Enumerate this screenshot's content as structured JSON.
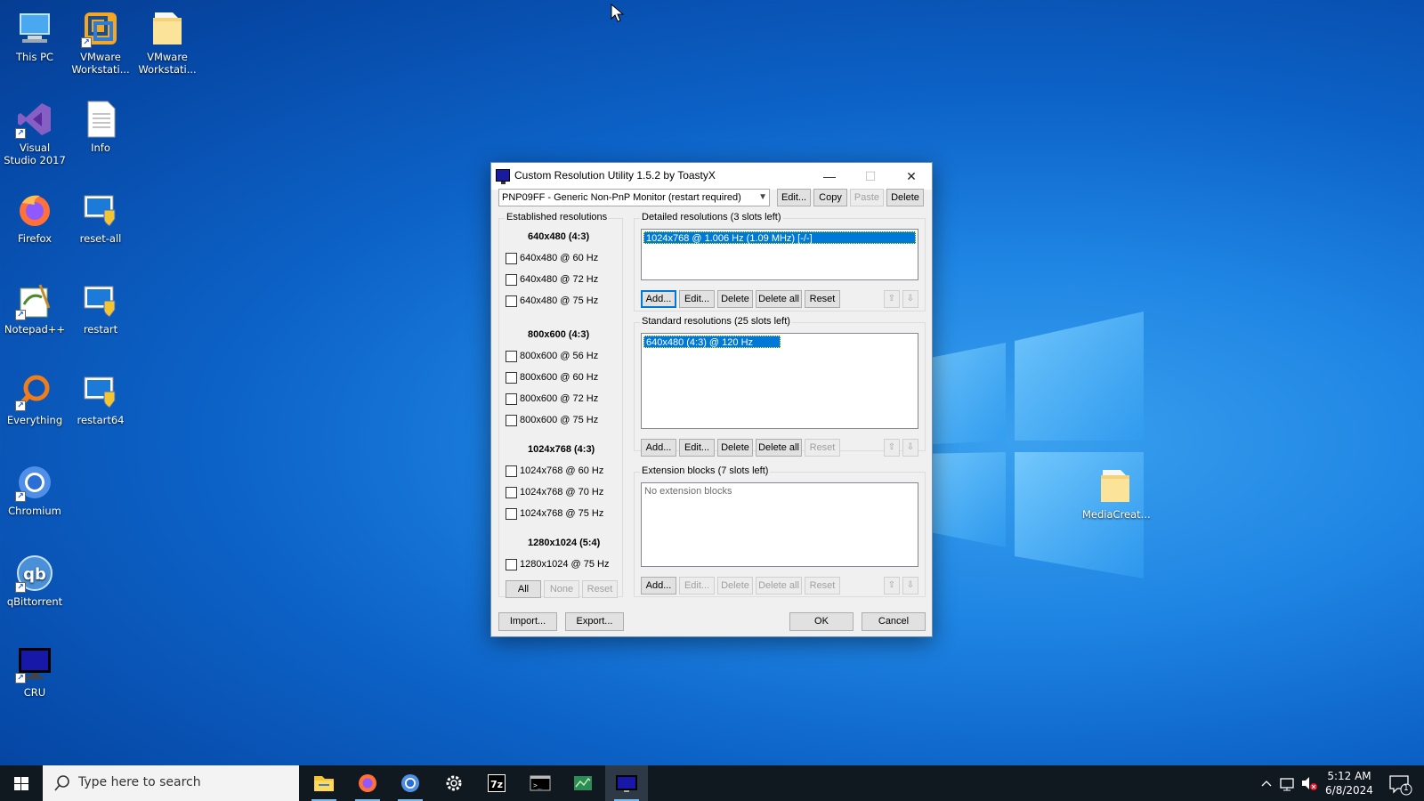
{
  "desktop": {
    "icons": [
      {
        "label": "This PC",
        "icon": "this-pc-icon"
      },
      {
        "label": "VMware Workstati...",
        "icon": "vmware-icon"
      },
      {
        "label": "VMware Workstati...",
        "icon": "folder-icon"
      },
      {
        "label": "Visual Studio 2017",
        "icon": "visual-studio-icon"
      },
      {
        "label": "Info",
        "icon": "text-file-icon"
      },
      {
        "label": "Firefox",
        "icon": "firefox-icon"
      },
      {
        "label": "reset-all",
        "icon": "monitor-shield-icon"
      },
      {
        "label": "Notepad++",
        "icon": "notepadpp-icon"
      },
      {
        "label": "restart",
        "icon": "monitor-shield-icon"
      },
      {
        "label": "Everything",
        "icon": "everything-search-icon"
      },
      {
        "label": "restart64",
        "icon": "monitor-shield-icon"
      },
      {
        "label": "Chromium",
        "icon": "chromium-icon"
      },
      {
        "label": "qBittorrent",
        "icon": "qbittorrent-icon"
      },
      {
        "label": "CRU",
        "icon": "cru-monitor-icon"
      },
      {
        "label": "MediaCreat...",
        "icon": "folder-icon"
      }
    ]
  },
  "dialog": {
    "title": "Custom Resolution Utility 1.5.2 by ToastyX",
    "title_buttons": {
      "minimize": "—",
      "maximize": "☐",
      "close": "✕"
    },
    "monitor_select": "PNP09FF - Generic Non-PnP Monitor (restart required)",
    "monitor_buttons": {
      "edit": "Edit...",
      "copy": "Copy",
      "paste": "Paste",
      "delete": "Delete"
    },
    "established": {
      "title": "Established resolutions",
      "groups": [
        {
          "header": "640x480 (4:3)",
          "items": [
            "640x480 @ 60 Hz",
            "640x480 @ 72 Hz",
            "640x480 @ 75 Hz"
          ]
        },
        {
          "header": "800x600 (4:3)",
          "items": [
            "800x600 @ 56 Hz",
            "800x600 @ 60 Hz",
            "800x600 @ 72 Hz",
            "800x600 @ 75 Hz"
          ]
        },
        {
          "header": "1024x768 (4:3)",
          "items": [
            "1024x768 @ 60 Hz",
            "1024x768 @ 70 Hz",
            "1024x768 @ 75 Hz"
          ]
        },
        {
          "header": "1280x1024 (5:4)",
          "items": [
            "1280x1024 @ 75 Hz"
          ]
        }
      ],
      "buttons": {
        "all": "All",
        "none": "None",
        "reset": "Reset"
      }
    },
    "detailed": {
      "title": "Detailed resolutions (3 slots left)",
      "items": [
        "1024x768 @ 1.006 Hz (1.09 MHz) [-/-]"
      ],
      "buttons": {
        "add": "Add...",
        "edit": "Edit...",
        "delete": "Delete",
        "delete_all": "Delete all",
        "reset": "Reset"
      }
    },
    "standard": {
      "title": "Standard resolutions (25 slots left)",
      "items": [
        "640x480 (4:3) @ 120 Hz"
      ],
      "buttons": {
        "add": "Add...",
        "edit": "Edit...",
        "delete": "Delete",
        "delete_all": "Delete all",
        "reset": "Reset"
      }
    },
    "extension": {
      "title": "Extension blocks (7 slots left)",
      "placeholder": "No extension blocks",
      "buttons": {
        "add": "Add...",
        "edit": "Edit...",
        "delete": "Delete",
        "delete_all": "Delete all",
        "reset": "Reset"
      }
    },
    "arrows": {
      "up": "⇧",
      "down": "⇩"
    },
    "footer": {
      "import": "Import...",
      "export": "Export...",
      "ok": "OK",
      "cancel": "Cancel"
    }
  },
  "taskbar": {
    "search_placeholder": "Type here to search",
    "apps": [
      "file-explorer-icon",
      "firefox-icon",
      "chromium-icon",
      "settings-gear-icon",
      "7zip-icon",
      "terminal-icon",
      "task-manager-icon",
      "cru-monitor-icon"
    ],
    "clock_time": "5:12 AM",
    "clock_date": "6/8/2024",
    "notification_count": "1"
  },
  "colors": {
    "accent": "#0078d7",
    "desktop_blue": "#0d63c8",
    "taskbar": "#101820"
  }
}
